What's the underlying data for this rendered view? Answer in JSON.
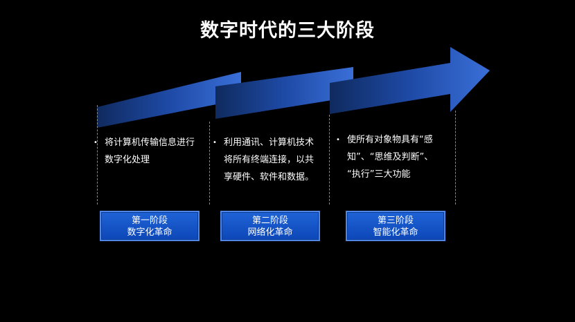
{
  "title": "数字时代的三大阶段",
  "colors": {
    "background": "#000000",
    "arrow_dark": "#0f2a5e",
    "arrow_light": "#3a6fd8",
    "stage_fill": "#1656c8"
  },
  "columns": [
    {
      "desc_lines": [
        "将计算机传输信息进行",
        "数字化处理"
      ],
      "stage_line1": "第一阶段",
      "stage_line2": "数字化革命"
    },
    {
      "desc_lines": [
        "利用通讯、计算机技术",
        "将所有终端连接，以共",
        "享硬件、软件和数据。"
      ],
      "stage_line1": "第二阶段",
      "stage_line2": "网络化革命"
    },
    {
      "desc_lines": [
        "使所有对象物具有“感",
        "知”、“思维及判断”、",
        "“执行”三大功能"
      ],
      "stage_line1": "第三阶段",
      "stage_line2": "智能化革命"
    }
  ]
}
